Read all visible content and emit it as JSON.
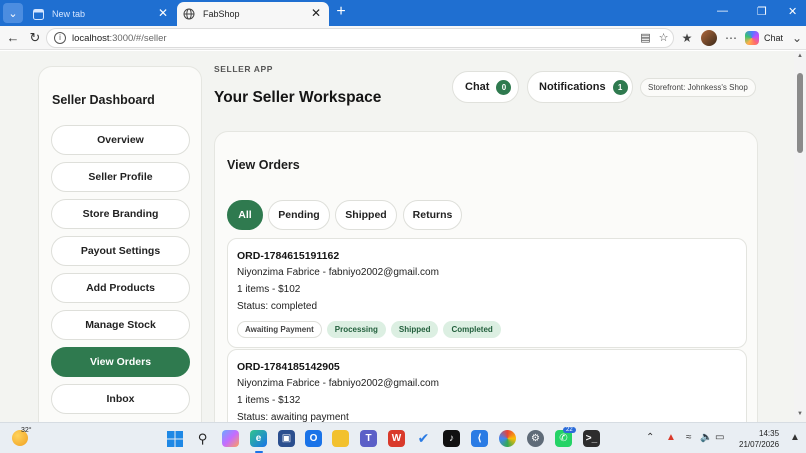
{
  "browser": {
    "tabs": [
      {
        "label": "New tab",
        "active": false
      },
      {
        "label": "FabShop",
        "active": true
      }
    ],
    "address": {
      "host": "localhost",
      "rest": ":3000/#/seller"
    },
    "copilot_label": "Chat"
  },
  "sidebar": {
    "title": "Seller Dashboard",
    "items": [
      {
        "label": "Overview",
        "active": false
      },
      {
        "label": "Seller Profile",
        "active": false
      },
      {
        "label": "Store Branding",
        "active": false
      },
      {
        "label": "Payout Settings",
        "active": false
      },
      {
        "label": "Add Products",
        "active": false
      },
      {
        "label": "Manage Stock",
        "active": false
      },
      {
        "label": "View Orders",
        "active": true
      },
      {
        "label": "Inbox",
        "active": false
      }
    ]
  },
  "header": {
    "eyebrow": "SELLER APP",
    "title": "Your Seller Workspace",
    "chat_label": "Chat",
    "chat_count": "0",
    "notifications_label": "Notifications",
    "notifications_count": "1",
    "storefront": "Storefront:  Johnkess's Shop"
  },
  "orders": {
    "title": "View Orders",
    "filters": [
      {
        "label": "All",
        "active": true
      },
      {
        "label": "Pending",
        "active": false
      },
      {
        "label": "Shipped",
        "active": false
      },
      {
        "label": "Returns",
        "active": false
      }
    ],
    "list": [
      {
        "id": "ORD-1784615191162",
        "customer": "Niyonzima Fabrice - fabniyo2002@gmail.com",
        "summary": "1 items - $102",
        "status": "Status: completed",
        "steps": [
          {
            "label": "Awaiting Payment",
            "done": false
          },
          {
            "label": "Processing",
            "done": true
          },
          {
            "label": "Shipped",
            "done": true
          },
          {
            "label": "Completed",
            "done": true
          }
        ]
      },
      {
        "id": "ORD-1784185142905",
        "customer": "Niyonzima Fabrice - fabniyo2002@gmail.com",
        "summary": "1 items - $132",
        "status": "Status: awaiting payment"
      }
    ]
  },
  "taskbar": {
    "temperature": "32°",
    "whatsapp_badge": "22",
    "time": "14:35",
    "date": "21/07/2026"
  },
  "colors": {
    "accent": "#2f7a4f",
    "accent_soft": "#dcefe2",
    "browser_blue": "#1f6fd1",
    "page_bg": "#f3f4f1"
  }
}
